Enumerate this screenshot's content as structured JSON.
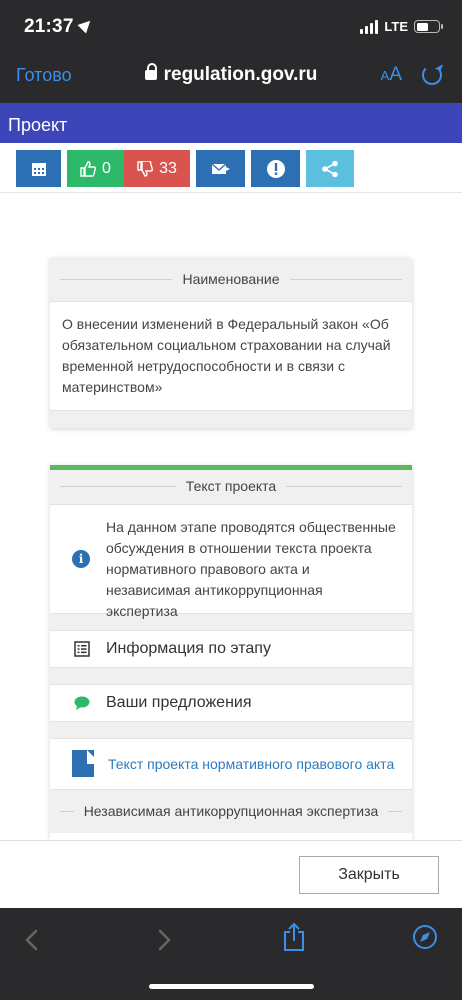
{
  "status": {
    "time": "21:37",
    "network": "LTE",
    "battery_level": 0.55
  },
  "browser": {
    "done_label": "Готово",
    "url": "regulation.gov.ru",
    "text_size_label_small": "A",
    "text_size_label_big": "A"
  },
  "page": {
    "section_title": "Проект"
  },
  "toolbar": {
    "likes": "0",
    "dislikes": "33"
  },
  "name_card": {
    "heading": "Наименование",
    "text": "О внесении изменений в Федеральный закон «Об обязательном социальном страховании на случай временной нетрудоспособности и в связи с материнством»"
  },
  "text_card": {
    "heading": "Текст проекта",
    "notice": "На данном этапе проводятся общественные обсуждения в отношении текста проекта нормативного правового акта и независимая антикоррупционная экспертиза",
    "stage_info": "Информация по этапу",
    "proposals": "Ваши предложения",
    "document_link": "Текст проекта нормативного правового акта",
    "document_ext": "DOCX",
    "expertise_heading": "Независимая антикоррупционная экспертиза"
  },
  "footer": {
    "close_label": "Закрыть"
  },
  "colors": {
    "header": "#3d46b8",
    "like": "#2eb86a",
    "dislike": "#d9534f",
    "primary": "#2c6fb3",
    "share": "#5bc0de",
    "accent_link": "#3b8fe8"
  }
}
